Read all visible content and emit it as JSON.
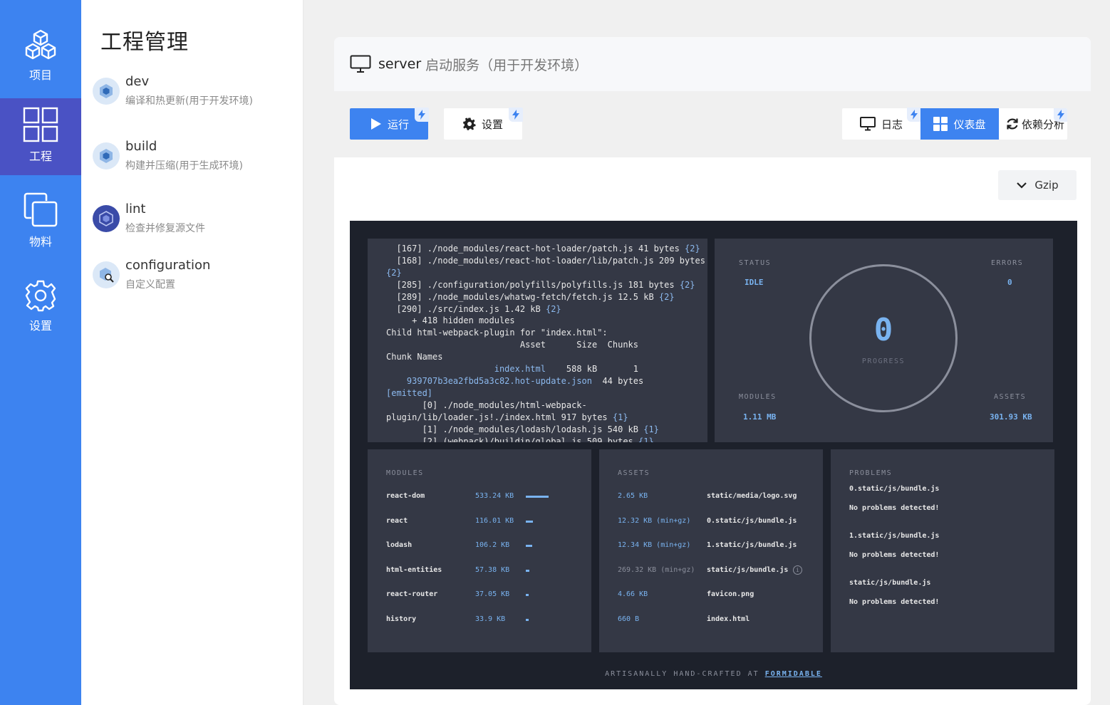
{
  "nav": {
    "items": [
      {
        "label": "项目",
        "icon": "cubes-icon"
      },
      {
        "label": "工程",
        "icon": "grid-icon"
      },
      {
        "label": "物料",
        "icon": "copy-icon"
      },
      {
        "label": "设置",
        "icon": "gear-icon"
      }
    ]
  },
  "project_list": {
    "title": "工程管理",
    "items": [
      {
        "name": "dev",
        "desc": "编译和热更新(用于开发环境)"
      },
      {
        "name": "build",
        "desc": "构建并压缩(用于生成环境)"
      },
      {
        "name": "lint",
        "desc": "检查并修复源文件"
      },
      {
        "name": "configuration",
        "desc": "自定义配置"
      }
    ]
  },
  "card": {
    "name": "server",
    "desc": "启动服务（用于开发环境）"
  },
  "toolbar": {
    "run": "运行",
    "settings": "设置",
    "log": "日志",
    "dashboard": "仪表盘",
    "analyze": "依赖分析"
  },
  "gzip": "Gzip",
  "dashboard": {
    "log_lines": [
      "  [167] ./node_modules/react-hot-loader/patch.js 41 bytes {2}",
      "  [168] ./node_modules/react-hot-loader/lib/patch.js 209 bytes",
      "{2}",
      "  [285] ./configuration/polyfills/polyfills.js 181 bytes {2}",
      "  [289] ./node_modules/whatwg-fetch/fetch.js 12.5 kB {2}",
      "  [290] ./src/index.js 1.42 kB {2}",
      "     + 418 hidden modules",
      "Child html-webpack-plugin for \"index.html\":",
      "                          Asset      Size  Chunks",
      "Chunk Names",
      "                     index.html    588 kB       1",
      "    939707b3ea2fbd5a3c82.hot-update.json  44 bytes",
      "[emitted]",
      "       [0] ./node_modules/html-webpack-",
      "plugin/lib/loader.js!./index.html 917 bytes {1}",
      "       [1] ./node_modules/lodash/lodash.js 540 kB {1}",
      "       [2] (webpack)/buildin/global.js 509 bytes {1}"
    ],
    "status": {
      "status_label": "STATUS",
      "status_value": "IDLE",
      "errors_label": "ERRORS",
      "errors_value": "0",
      "modules_label": "MODULES",
      "modules_value": "1.11 MB",
      "assets_label": "ASSETS",
      "assets_value": "301.93 KB",
      "progress_value": "0",
      "progress_label": "PROGRESS"
    },
    "modules_title": "MODULES",
    "modules": [
      {
        "name": "react-dom",
        "size": "533.24 KB",
        "ratio": 1.0
      },
      {
        "name": "react",
        "size": "116.01 KB",
        "ratio": 0.3
      },
      {
        "name": "lodash",
        "size": "106.2 KB",
        "ratio": 0.28
      },
      {
        "name": "html-entities",
        "size": "57.38 KB",
        "ratio": 0.17
      },
      {
        "name": "react-router",
        "size": "37.05 KB",
        "ratio": 0.14
      },
      {
        "name": "history",
        "size": "33.9 KB",
        "ratio": 0.13
      }
    ],
    "assets_title": "ASSETS",
    "assets": [
      {
        "size": "2.65 KB",
        "name": "static/media/logo.svg",
        "dim": false,
        "info": false
      },
      {
        "size": "12.32 KB (min+gz)",
        "name": "0.static/js/bundle.js",
        "dim": false,
        "info": false
      },
      {
        "size": "12.34 KB (min+gz)",
        "name": "1.static/js/bundle.js",
        "dim": false,
        "info": false
      },
      {
        "size": "269.32 KB (min+gz)",
        "name": "static/js/bundle.js",
        "dim": true,
        "info": true
      },
      {
        "size": "4.66 KB",
        "name": "favicon.png",
        "dim": false,
        "info": false
      },
      {
        "size": "660 B",
        "name": "index.html",
        "dim": false,
        "info": false
      }
    ],
    "info_glyph": "i",
    "problems_title": "PROBLEMS",
    "problems": [
      "0.static/js/bundle.js",
      "No problems detected!",
      "1.static/js/bundle.js",
      "No problems detected!",
      "static/js/bundle.js",
      "No problems detected!"
    ],
    "footer_text": "ARTISANALLY HAND-CRAFTED AT",
    "footer_link": "FORMIDABLE"
  }
}
